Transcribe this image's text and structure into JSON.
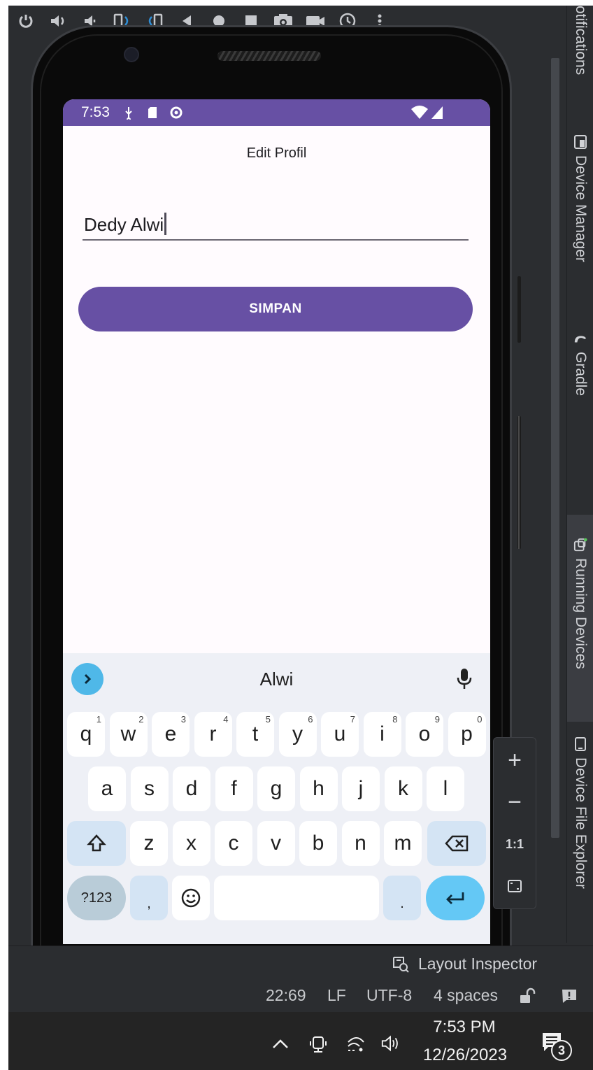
{
  "ide": {
    "side_tabs": {
      "notifications": "otifications",
      "device_manager": "Device Manager",
      "gradle": "Gradle",
      "running_devices": "Running Devices",
      "device_file_explorer": "Device File Explorer"
    },
    "zoom": {
      "zoom_in": "+",
      "zoom_out": "−",
      "actual_size": "1:1"
    },
    "layout_inspector": "Layout Inspector",
    "status": {
      "position": "22:69",
      "line_ending": "LF",
      "encoding": "UTF-8",
      "indent": "4 spaces"
    },
    "colors": {
      "ide_background": "#2b2d30"
    }
  },
  "device": {
    "status_bar": {
      "time": "7:53"
    },
    "app": {
      "title": "Edit Profil",
      "name_value": "Dedy Alwi",
      "save_label": "SIMPAN",
      "colors": {
        "primary": "#6750a4",
        "background": "#fffbfe"
      }
    },
    "keyboard": {
      "suggestion": "Alwi",
      "row1": [
        {
          "k": "q",
          "h": "1"
        },
        {
          "k": "w",
          "h": "2"
        },
        {
          "k": "e",
          "h": "3"
        },
        {
          "k": "r",
          "h": "4"
        },
        {
          "k": "t",
          "h": "5"
        },
        {
          "k": "y",
          "h": "6"
        },
        {
          "k": "u",
          "h": "7"
        },
        {
          "k": "i",
          "h": "8"
        },
        {
          "k": "o",
          "h": "9"
        },
        {
          "k": "p",
          "h": "0"
        }
      ],
      "row2": [
        "a",
        "s",
        "d",
        "f",
        "g",
        "h",
        "j",
        "k",
        "l"
      ],
      "row3": [
        "z",
        "x",
        "c",
        "v",
        "b",
        "n",
        "m"
      ],
      "symbols_label": "?123",
      "comma": ",",
      "period": "."
    }
  },
  "taskbar": {
    "time": "7:53 PM",
    "date": "12/26/2023",
    "notifications_count": "3"
  }
}
